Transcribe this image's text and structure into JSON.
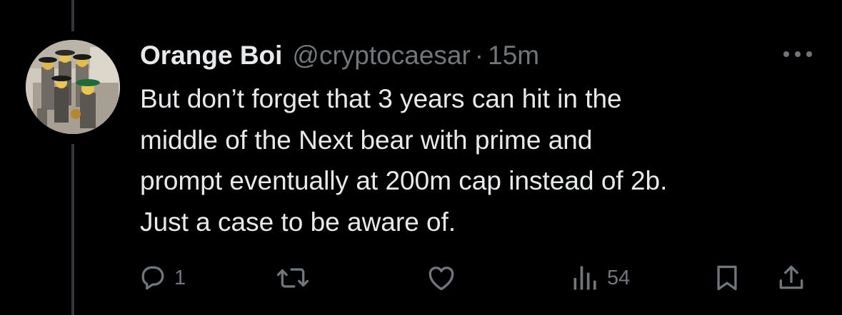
{
  "tweet": {
    "display_name": "Orange Boi",
    "handle": "@cryptocaesar",
    "separator": "·",
    "time": "15m",
    "text": "But don’t forget that 3 years can hit in the\nmiddle of the Next bear with prime and\nprompt eventually at 200m cap instead of 2b.\nJust a case to be aware of.",
    "avatar_icon": "avatar-photo"
  },
  "actions": {
    "reply": {
      "icon": "reply-icon",
      "count": "1"
    },
    "retweet": {
      "icon": "retweet-icon",
      "count": ""
    },
    "like": {
      "icon": "heart-icon",
      "count": ""
    },
    "views": {
      "icon": "views-icon",
      "count": "54"
    },
    "bookmark": {
      "icon": "bookmark-icon"
    },
    "share": {
      "icon": "share-icon"
    },
    "more": {
      "icon": "more-icon"
    }
  },
  "colors": {
    "background": "#000000",
    "text_primary": "#e7e9ea",
    "text_secondary": "#71767b",
    "thread_line": "#333639"
  }
}
